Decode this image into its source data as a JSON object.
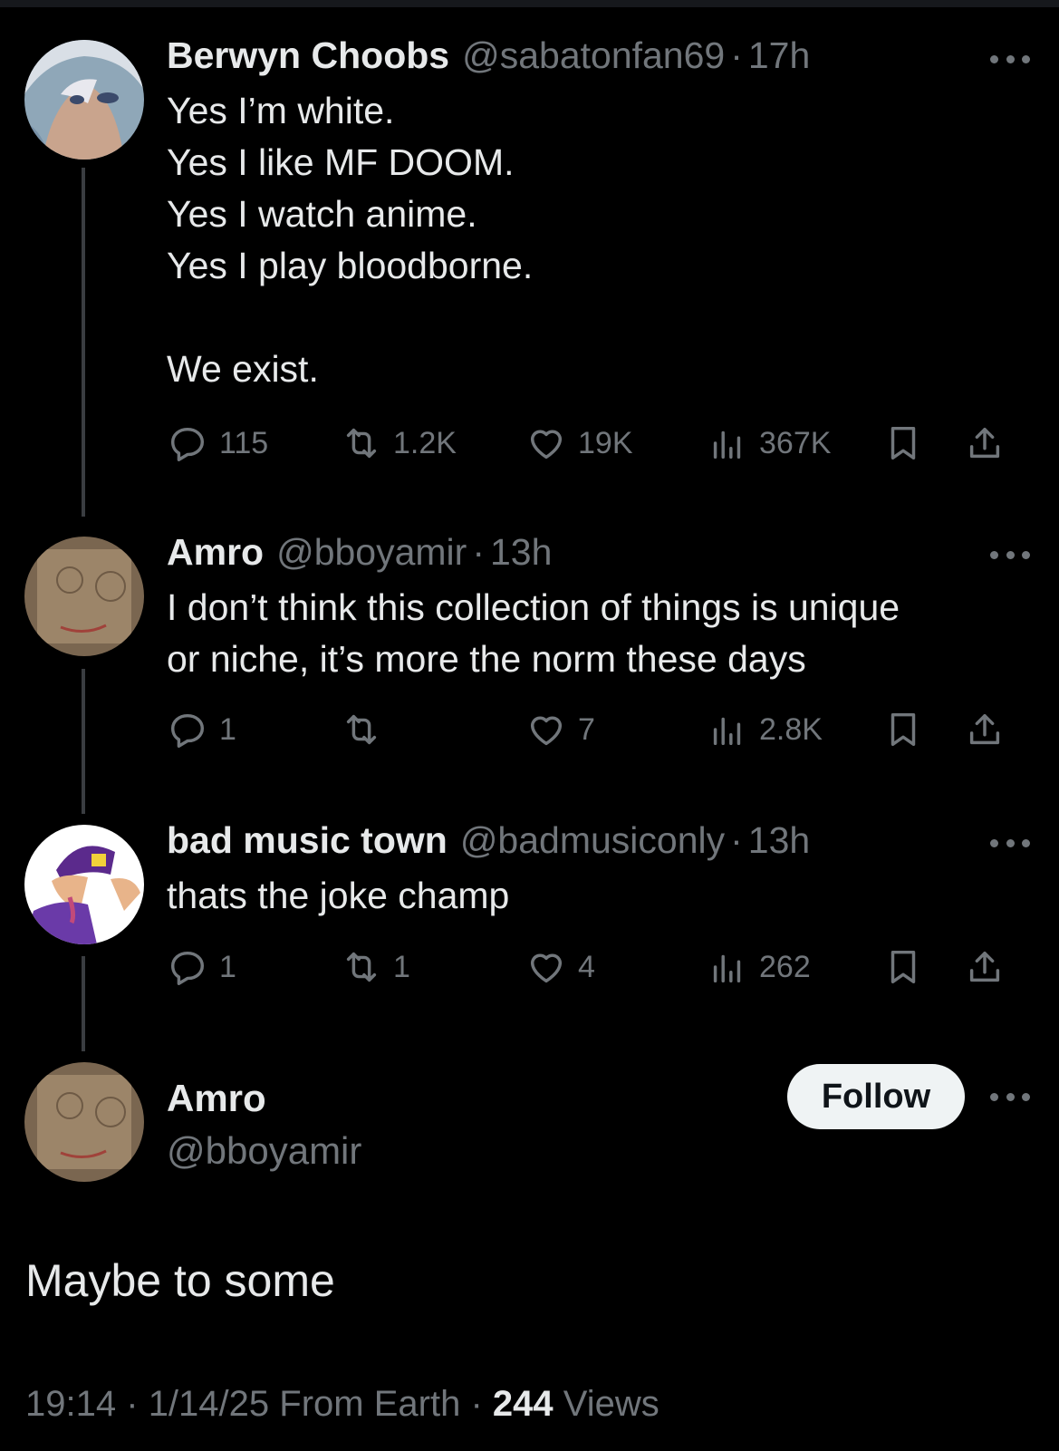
{
  "tweets": [
    {
      "name": "Berwyn Choobs",
      "handle": "@sabatonfan69",
      "time": "17h",
      "text": "Yes I’m white.\nYes I like MF DOOM.\nYes I watch anime.\nYes I play bloodborne.\n\nWe exist.",
      "replies": "115",
      "reposts": "1.2K",
      "likes": "19K",
      "views": "367K"
    },
    {
      "name": "Amro",
      "handle": "@bboyamir",
      "time": "13h",
      "text": "I don’t think this collection of things is unique\nor niche, it’s more the norm these days",
      "replies": "1",
      "reposts": "",
      "likes": "7",
      "views": "2.8K"
    },
    {
      "name": "bad music town",
      "handle": "@badmusiconly",
      "time": "13h",
      "text": "thats the joke champ",
      "replies": "1",
      "reposts": "1",
      "likes": "4",
      "views": "262"
    }
  ],
  "main": {
    "name": "Amro",
    "handle": "@bboyamir",
    "follow_label": "Follow",
    "text": "Maybe to some",
    "time": "19:14",
    "date": "1/14/25",
    "source": "From Earth",
    "views_count": "244",
    "views_label": "Views"
  },
  "separator": "·",
  "icons": {
    "reply": "reply-icon",
    "repost": "repost-icon",
    "like": "heart-icon",
    "views": "views-icon",
    "bookmark": "bookmark-icon",
    "share": "share-icon",
    "more": "more-icon"
  },
  "colors": {
    "background": "#000000",
    "text": "#e7e9ea",
    "muted": "#71767b",
    "follow_bg": "#eff3f4"
  }
}
